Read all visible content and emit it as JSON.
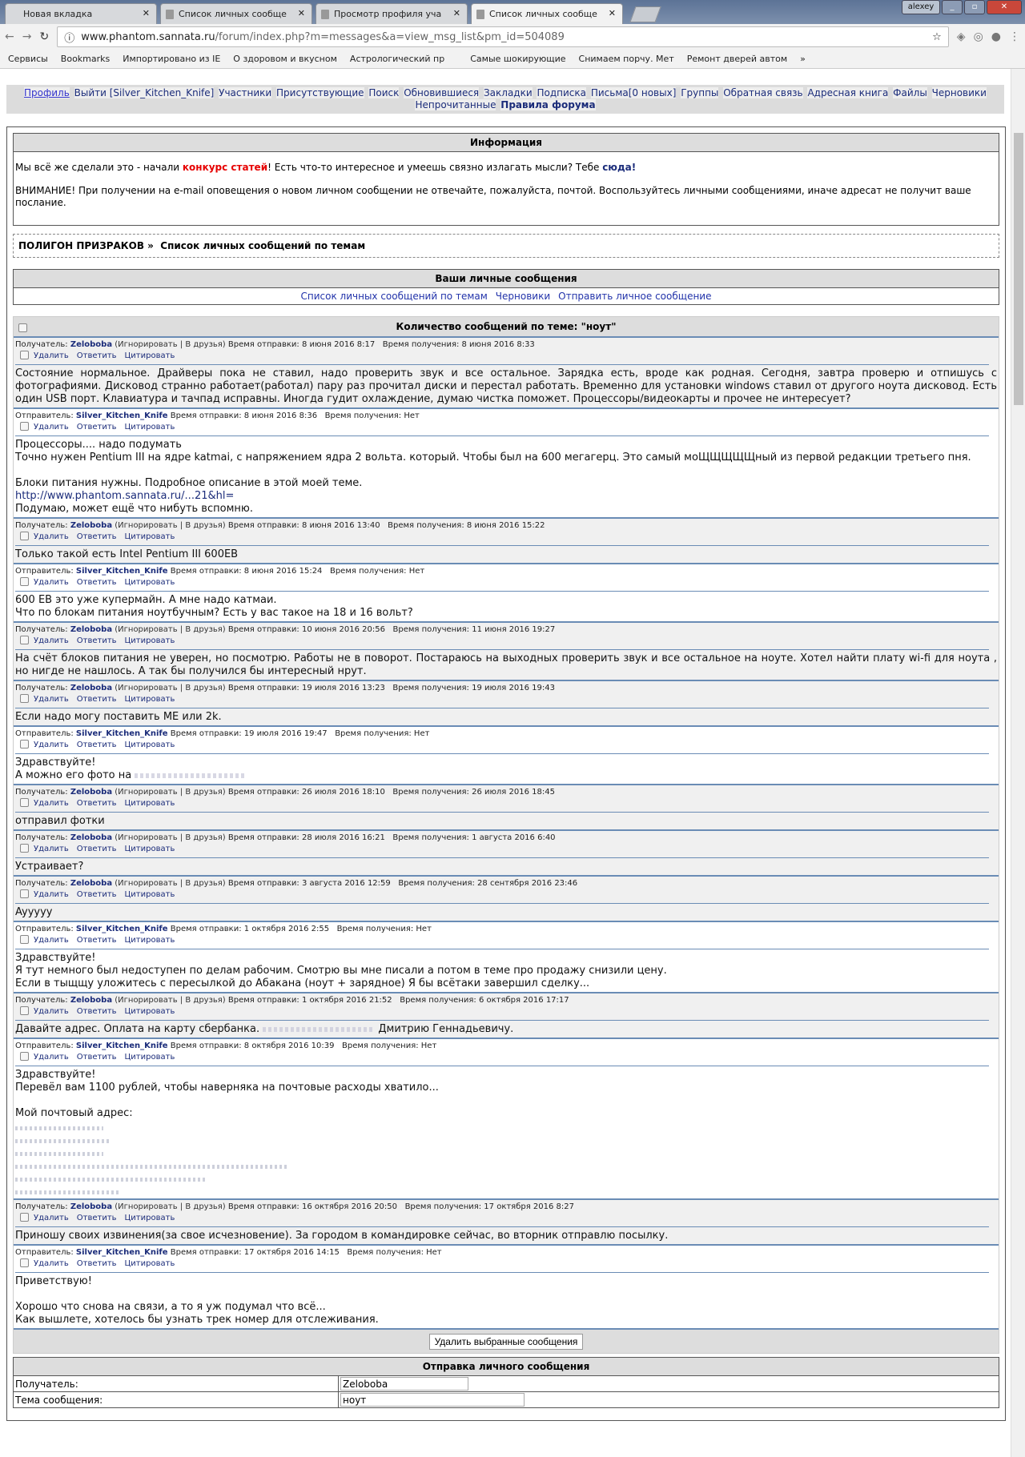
{
  "browser": {
    "tabs": [
      {
        "label": "Новая вкладка"
      },
      {
        "label": "Список личных сообще"
      },
      {
        "label": "Просмотр профиля уча"
      },
      {
        "label": "Список личных сообще"
      }
    ],
    "user": "alexey",
    "url_host": "www.phantom.sannata.ru",
    "url_path": "/forum/index.php?m=messages&a=view_msg_list&pm_id=504089",
    "bookmarks": [
      "Сервисы",
      "Bookmarks",
      "Импортировано из IE",
      "О здоровом и вкусном",
      "Астрологический пр",
      "",
      "Самые шокирующие",
      "Снимаем порчу. Мет",
      "Ремонт дверей автом"
    ]
  },
  "nav": {
    "items": [
      "Профиль",
      "Выйти [Silver_Kitchen_Knife]",
      "Участники",
      "Присутствующие",
      "Поиск",
      "Обновившиеся",
      "Закладки",
      "Подписка",
      "Письма[0 новых]",
      "Группы",
      "Обратная связь",
      "Адресная книга",
      "Файлы",
      "Черновики",
      "Непрочитанные"
    ],
    "rules": "Правила форума"
  },
  "info": {
    "title": "Информация",
    "p1_a": "Мы всё же сделали это - начали ",
    "p1_link": "конкурс статей",
    "p1_b": "! Есть что-то интересное и умеешь связно излагать мысли? Тебе ",
    "p1_here": "сюда!",
    "p2": "ВНИМАНИЕ! При получении на e-mail оповещения о новом личном сообщении не отвечайте, пожалуйста, почтой. Воспользуйтесь личными сообщениями, иначе адресат не получит ваше послание."
  },
  "breadcrumb": {
    "forum": "ПОЛИГОН ПРИЗРАКОВ »",
    "page": "Список личных сообщений по темам"
  },
  "pm": {
    "title": "Ваши личные сообщения",
    "links": [
      "Список личных сообщений по темам",
      "Черновики",
      "Отправить личное сообщение"
    ]
  },
  "thread": {
    "title": "Количество сообщений по теме: \"ноут\"",
    "labels": {
      "to": "Получатель:",
      "from": "Отправитель:",
      "ignore": "(Игнорировать",
      "friends": "| В друзья)",
      "sent": "Время отправки:",
      "recv": "Время получения:",
      "delete": "Удалить",
      "reply": "Ответить",
      "quote": "Цитировать"
    },
    "messages": [
      {
        "dir": "in",
        "user": "Zeloboba",
        "sent": "8 июня 2016 8:17",
        "recv": "8 июня 2016 8:33",
        "justify": true,
        "body": "Состояние нормальное. Драйверы пока не ставил, надо проверить звук и все остальное. Зарядка есть, вроде как родная. Сегодня, завтра проверю и отпишусь с фотографиями. Дисковод странно работает(работал) пару раз прочитал диски и перестал работать. Временно для установки windows ставил от другого ноута дисковод. Есть один USB порт. Клавиатура и тачпад исправны. Иногда гудит охлаждение, думаю чистка поможет. Процессоры/видеокарты и прочее не интересует?"
      },
      {
        "dir": "out",
        "user": "Silver_Kitchen_Knife",
        "sent": "8 июня 2016 8:36",
        "recv": "Нет",
        "body": "Процессоры.... надо подумать\nТочно нужен Pentium III на ядре katmai, с напряжением ядра 2 вольта. который. Чтобы был на 600 мегагерц. Это самый моЩЩЩЩЩный из первой редакции третьего пня.\n\nБлоки питания нужны. Подробное описание в этой моей теме.",
        "link": "http://www.phantom.sannata.ru/...21&hl=",
        "body2": "\nПодумаю, может ещё что нибуть вспомню."
      },
      {
        "dir": "in",
        "user": "Zeloboba",
        "sent": "8 июня 2016 13:40",
        "recv": "8 июня 2016 15:22",
        "body": "Только такой есть Intel Pentium III 600EB"
      },
      {
        "dir": "out",
        "user": "Silver_Kitchen_Knife",
        "sent": "8 июня 2016 15:24",
        "recv": "Нет",
        "body": "600 ЕВ это уже купермайн. А мне надо катмаи.\nЧто по блокам питания ноутбучным? Есть у вас такое на 18 и 16 вольт?"
      },
      {
        "dir": "in",
        "user": "Zeloboba",
        "sent": "10 июня 2016 20:56",
        "recv": "11 июня 2016 19:27",
        "justify": true,
        "body": "На счёт блоков питания не уверен, но посмотрю. Работы не в поворот. Постараюсь на выходных проверить звук и все остальное на ноуте. Хотел найти плату wi-fi для ноута , но нигде не нашлось. А так бы получился бы интересный нрут."
      },
      {
        "dir": "in",
        "user": "Zeloboba",
        "sent": "19 июля 2016 13:23",
        "recv": "19 июля 2016 19:43",
        "body": "Если надо могу поставить МЕ или 2k."
      },
      {
        "dir": "out",
        "user": "Silver_Kitchen_Knife",
        "sent": "19 июля 2016 19:47",
        "recv": "Нет",
        "body": "Здравствуйте!\nА можно его фото на ",
        "redacted": true
      },
      {
        "dir": "in",
        "user": "Zeloboba",
        "sent": "26 июля 2016 18:10",
        "recv": "26 июля 2016 18:45",
        "body": "отправил фотки"
      },
      {
        "dir": "in",
        "user": "Zeloboba",
        "sent": "28 июля 2016 16:21",
        "recv": "1 августа 2016 6:40",
        "body": "Устраивает?"
      },
      {
        "dir": "in",
        "user": "Zeloboba",
        "sent": "3 августа 2016 12:59",
        "recv": "28 сентября 2016 23:46",
        "body": "Ayyyyy"
      },
      {
        "dir": "out",
        "user": "Silver_Kitchen_Knife",
        "sent": "1 октября 2016 2:55",
        "recv": "Нет",
        "body": "Здравствуйте!\nЯ тут немного был недоступен по делам рабочим. Смотрю вы мне писали а потом в теме про продажу снизили цену.\nЕсли в тыщщу уложитесь с пересылкой до Абакана (ноут + зарядное) Я бы всётаки завершил сделку..."
      },
      {
        "dir": "in",
        "user": "Zeloboba",
        "sent": "1 октября 2016 21:52",
        "recv": "6 октября 2016 17:17",
        "body": "Давайте адрес. Оплата на карту сбербанка. ",
        "redacted": true,
        "body2": " Дмитрию Геннадьевичу."
      },
      {
        "dir": "out",
        "user": "Silver_Kitchen_Knife",
        "sent": "8 октября 2016 10:39",
        "recv": "Нет",
        "body": "Здравствуйте!\nПеревёл вам 1100 рублей, чтобы наверняка на почтовые расходы хватило...\n\nМой почтовый адрес:",
        "address_lines": 6
      },
      {
        "dir": "in",
        "user": "Zeloboba",
        "sent": "16 октября 2016 20:50",
        "recv": "17 октября 2016 8:27",
        "body": "Приношу своих извинения(за свое исчезновение). За городом в командировке сейчас, во вторник отправлю посылку."
      },
      {
        "dir": "out",
        "user": "Silver_Kitchen_Knife",
        "sent": "17 октября 2016 14:15",
        "recv": "Нет",
        "body": "Приветствую!\n\nХорошо что снова на связи, а то я уж подумал что всё...\nКак вышлете, хотелось бы узнать трек номер для отслеживания."
      }
    ],
    "delete_selected": "Удалить выбранные сообщения"
  },
  "send": {
    "title": "Отправка личного сообщения",
    "recipient_label": "Получатель:",
    "recipient_value": "Zeloboba",
    "subject_label": "Тема сообщения:",
    "subject_value": "ноут"
  }
}
